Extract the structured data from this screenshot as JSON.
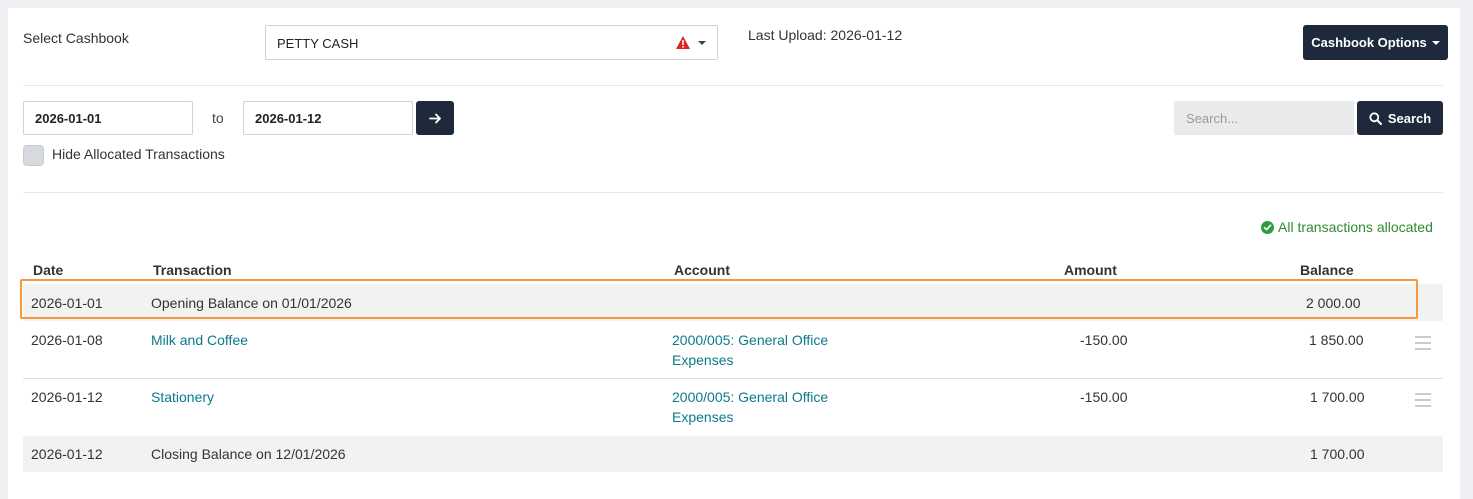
{
  "header": {
    "select_cashbook_label": "Select Cashbook",
    "cashbook_value": "PETTY CASH",
    "last_upload": "Last Upload: 2026-01-12",
    "cashbook_options_label": "Cashbook Options"
  },
  "filters": {
    "from_date": "2026-01-01",
    "to_label": "to",
    "to_date": "2026-01-12",
    "search_placeholder": "Search...",
    "search_button": "Search",
    "hide_allocated_label": "Hide Allocated Transactions",
    "hide_allocated_checked": false
  },
  "status": {
    "allocated_text": "All transactions allocated",
    "color": "#2e8b2e"
  },
  "table": {
    "columns": [
      "Date",
      "Transaction",
      "Account",
      "Amount",
      "Balance"
    ],
    "opening": {
      "date": "2026-01-01",
      "transaction": "Opening Balance on 01/01/2026",
      "balance": "2 000.00"
    },
    "rows": [
      {
        "date": "2026-01-08",
        "transaction": "Milk and Coffee",
        "account_line1": "2000/005: General Office",
        "account_line2": "Expenses",
        "amount": "-150.00",
        "balance": "1 850.00"
      },
      {
        "date": "2026-01-12",
        "transaction": "Stationery",
        "account_line1": "2000/005: General Office",
        "account_line2": "Expenses",
        "amount": "-150.00",
        "balance": "1 700.00"
      }
    ],
    "closing": {
      "date": "2026-01-12",
      "transaction": "Closing Balance on 12/01/2026",
      "balance": "1 700.00"
    }
  },
  "colors": {
    "dark_button": "#1e2a3b",
    "link": "#0b7a8a",
    "highlight_border": "#f39a3c",
    "warning": "#e02424"
  }
}
